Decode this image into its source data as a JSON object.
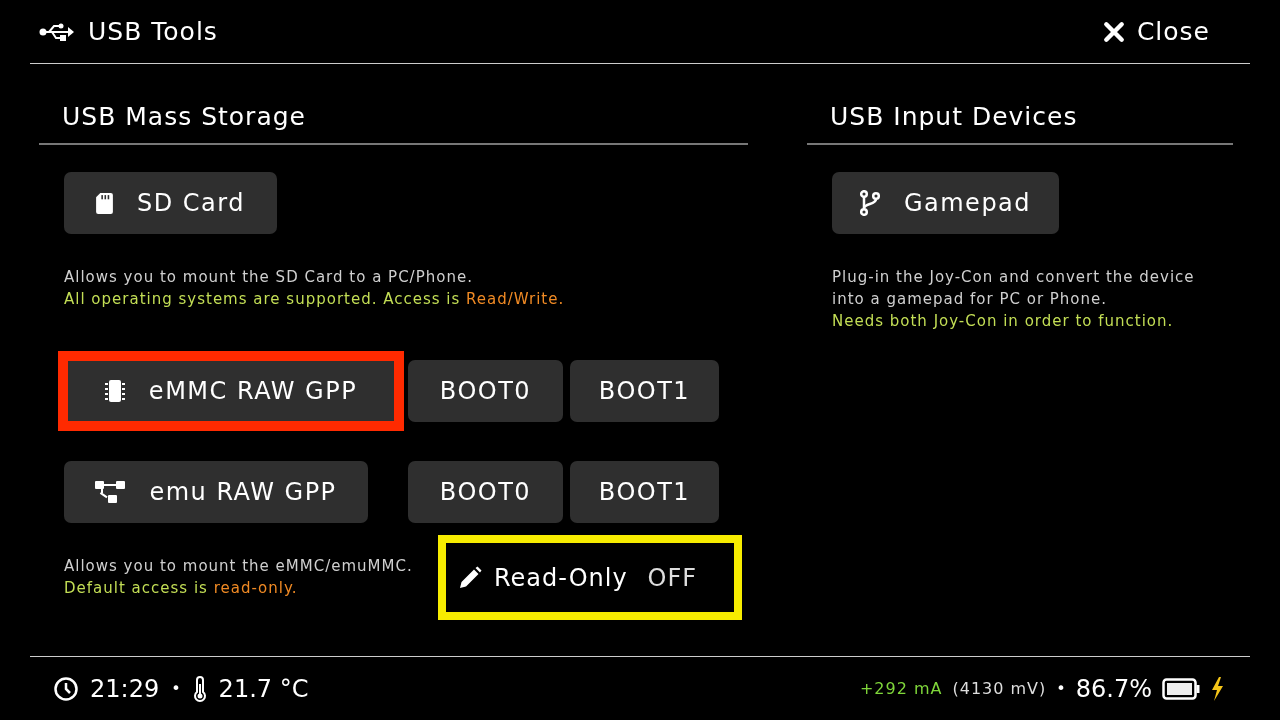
{
  "header": {
    "title": "USB Tools",
    "close_label": "Close"
  },
  "mass_storage": {
    "title": "USB Mass Storage",
    "sd_button": {
      "label": "SD Card",
      "selected": false
    },
    "sd_description": [
      [
        {
          "text": "Allows you to mount the SD Card to a PC/Phone.",
          "kind": "plain"
        }
      ],
      [
        {
          "text": "All operating systems are supported. Access is ",
          "kind": "note"
        },
        {
          "text": "Read/Write.",
          "kind": "access"
        }
      ]
    ],
    "rows": [
      {
        "buttons": [
          {
            "label": "eMMC RAW GPP",
            "selected": true
          },
          {
            "label": "BOOT0",
            "selected": false
          },
          {
            "label": "BOOT1",
            "selected": false
          }
        ]
      },
      {
        "buttons": [
          {
            "label": "emu RAW GPP",
            "selected": false
          },
          {
            "label": "BOOT0",
            "selected": false
          },
          {
            "label": "BOOT1",
            "selected": false
          }
        ]
      }
    ],
    "emmc_description": [
      [
        {
          "text": "Allows you to mount the eMMC/emuMMC.",
          "kind": "plain"
        }
      ],
      [
        {
          "text": "Default access is ",
          "kind": "note"
        },
        {
          "text": "read-only.",
          "kind": "access"
        }
      ]
    ],
    "read_only_toggle": {
      "label": "Read-Only",
      "value": "OFF",
      "highlighted": true
    }
  },
  "input_devices": {
    "title": "USB Input Devices",
    "gamepad_button": {
      "label": "Gamepad",
      "selected": false
    },
    "description": [
      [
        {
          "text": "Plug-in the Joy-Con and convert the device",
          "kind": "plain"
        }
      ],
      [
        {
          "text": "into a gamepad for PC or Phone.",
          "kind": "plain"
        }
      ],
      [
        {
          "text": "Needs both Joy-Con in order to function.",
          "kind": "note"
        }
      ]
    ]
  },
  "status_bar": {
    "time": "21:29",
    "separator_left": "•",
    "temperature": "21.7 °C",
    "current": "+292 mA",
    "voltage": "(4130 mV)",
    "separator_right": "•",
    "battery_percent": "86.7%",
    "charging": true
  }
}
